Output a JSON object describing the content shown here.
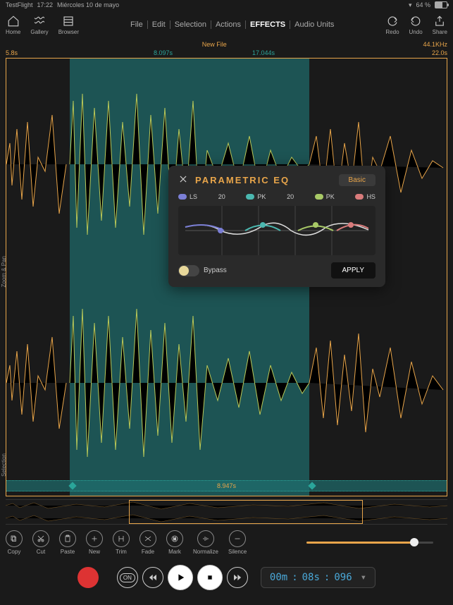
{
  "status": {
    "app": "TestFlight",
    "time": "17:22",
    "date": "Miércoles 10 de mayo",
    "battery": "64 %"
  },
  "toolbar": {
    "home": "Home",
    "gallery": "Gallery",
    "browser": "Browser",
    "redo": "Redo",
    "undo": "Undo",
    "share": "Share"
  },
  "menu": {
    "file": "File",
    "edit": "Edit",
    "selection": "Selection",
    "actions": "Actions",
    "effects": "EFFECTS",
    "audio_units": "Audio Units"
  },
  "file": {
    "name": "New File",
    "rate": "44.1KHz"
  },
  "timeline": {
    "start": "5.8s",
    "sel_start": "8.097s",
    "sel_end": "17.044s",
    "end": "22.0s",
    "sel_len": "8.947s"
  },
  "side": {
    "zoom": "Zoom & Pan",
    "selection": "Selection"
  },
  "eq": {
    "title": "PARAMETRIC EQ",
    "basic": "Basic",
    "bands": {
      "ls": "LS",
      "v1": "20",
      "pk1": "PK",
      "v2": "20",
      "pk2": "PK",
      "hs": "HS"
    },
    "bypass": "Bypass",
    "apply": "APPLY"
  },
  "tools": {
    "copy": "Copy",
    "cut": "Cut",
    "paste": "Paste",
    "new": "New",
    "trim": "Trim",
    "fade": "Fade",
    "mark": "Mark",
    "normalize": "Normalize",
    "silence": "Silence"
  },
  "transport": {
    "on": "ON"
  },
  "timecode": {
    "m": "00m",
    "s": "08s",
    "ms": "096"
  }
}
